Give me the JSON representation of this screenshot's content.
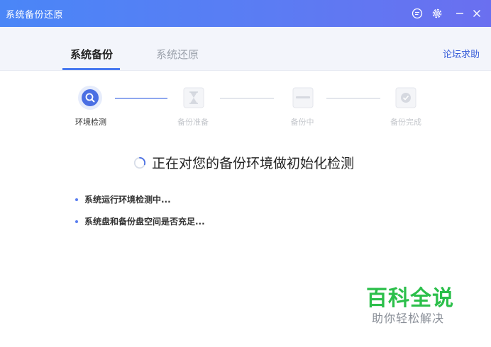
{
  "window": {
    "title": "系统备份还原"
  },
  "tabs": [
    {
      "label": "系统备份",
      "active": true
    },
    {
      "label": "系统还原",
      "active": false
    }
  ],
  "help_link": "论坛求助",
  "steps": [
    {
      "label": "环境检测",
      "icon": "search-icon",
      "active": true
    },
    {
      "label": "备份准备",
      "icon": "hourglass-icon",
      "active": false
    },
    {
      "label": "备份中",
      "icon": "progress-box-icon",
      "active": false
    },
    {
      "label": "备份完成",
      "icon": "checkmark-icon",
      "active": false
    }
  ],
  "status": {
    "message": "正在对您的备份环境做初始化检测"
  },
  "checks": [
    {
      "text": "系统运行环境检测中..."
    },
    {
      "text": "系统盘和备份盘空间是否充足..."
    }
  ],
  "watermark": {
    "title": "百科全说",
    "subtitle": "助你轻松解决"
  },
  "colors": {
    "accent": "#4a7af0",
    "titlebar_start": "#4a86f7",
    "titlebar_end": "#6a6ff0",
    "watermark": "#2bbf4a"
  }
}
